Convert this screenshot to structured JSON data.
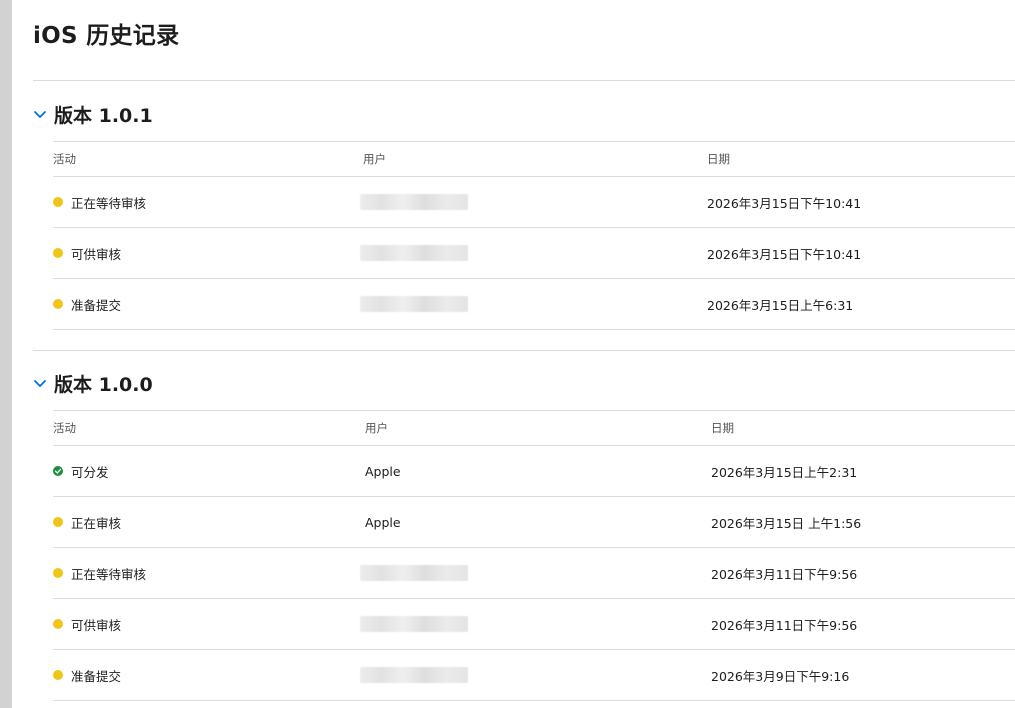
{
  "page": {
    "title": "iOS 历史记录"
  },
  "sections": [
    {
      "title": "版本 1.0.1",
      "columns": {
        "activity": "活动",
        "user": "用户",
        "date": "日期"
      },
      "rows": [
        {
          "activity": "正在等待审核",
          "status": "pending",
          "user": "",
          "date": "2026年3月15日下午10:41"
        },
        {
          "activity": "可供审核",
          "status": "pending",
          "user": "",
          "date": "2026年3月15日下午10:41"
        },
        {
          "activity": "准备提交",
          "status": "pending",
          "user": "",
          "date": "2026年3月15日上午6:31"
        }
      ]
    },
    {
      "title": "版本 1.0.0",
      "columns": {
        "activity": "活动",
        "user": "用户",
        "date": "日期"
      },
      "rows": [
        {
          "activity": "可分发",
          "status": "ok",
          "user": "Apple",
          "date": "2026年3月15日上午2:31"
        },
        {
          "activity": "正在审核",
          "status": "pending",
          "user": "Apple",
          "date": "2026年3月15日 上午1:56"
        },
        {
          "activity": "正在等待审核",
          "status": "pending",
          "user": "",
          "date": "2026年3月11日下午9:56"
        },
        {
          "activity": "可供审核",
          "status": "pending",
          "user": "",
          "date": "2026年3月11日下午9:56"
        },
        {
          "activity": "准备提交",
          "status": "pending",
          "user": "",
          "date": "2026年3月9日下午9:16"
        }
      ]
    }
  ],
  "colors": {
    "pending": "#f0c419",
    "ok": "#1e8e3e",
    "accent": "#0071e3"
  },
  "icons": {
    "section_toggle": "chevron-down-icon",
    "pending": "clock-icon",
    "ok": "checkmark-circle-icon"
  }
}
